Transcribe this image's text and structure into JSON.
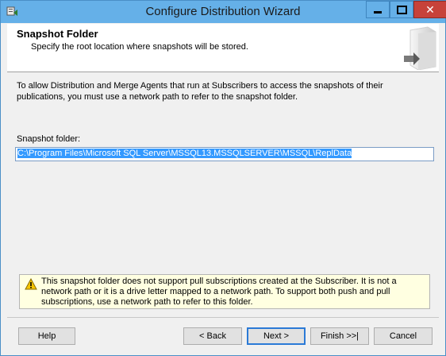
{
  "window": {
    "title": "Configure Distribution Wizard"
  },
  "header": {
    "title": "Snapshot Folder",
    "subtitle": "Specify the root location where snapshots will be stored."
  },
  "content": {
    "description": "To allow Distribution and Merge Agents that run at Subscribers to access the snapshots of their publications, you must use a network path to refer to the snapshot folder.",
    "folder_label": "Snapshot folder:",
    "folder_value": "C:\\Program Files\\Microsoft SQL Server\\MSSQL13.MSSQLSERVER\\MSSQL\\ReplData",
    "warning_text": "This snapshot folder does not support pull subscriptions created at the Subscriber. It is not a network path or it is a drive letter mapped to a network path. To support both push and pull subscriptions, use a network path to refer to this folder."
  },
  "buttons": {
    "help": "Help",
    "back": "< Back",
    "next": "Next >",
    "finish": "Finish >>|",
    "cancel": "Cancel"
  },
  "colors": {
    "titlebar": "#65b0e8",
    "close_button": "#c7423a",
    "selection": "#3399ff",
    "warning_background": "#ffffe1"
  }
}
